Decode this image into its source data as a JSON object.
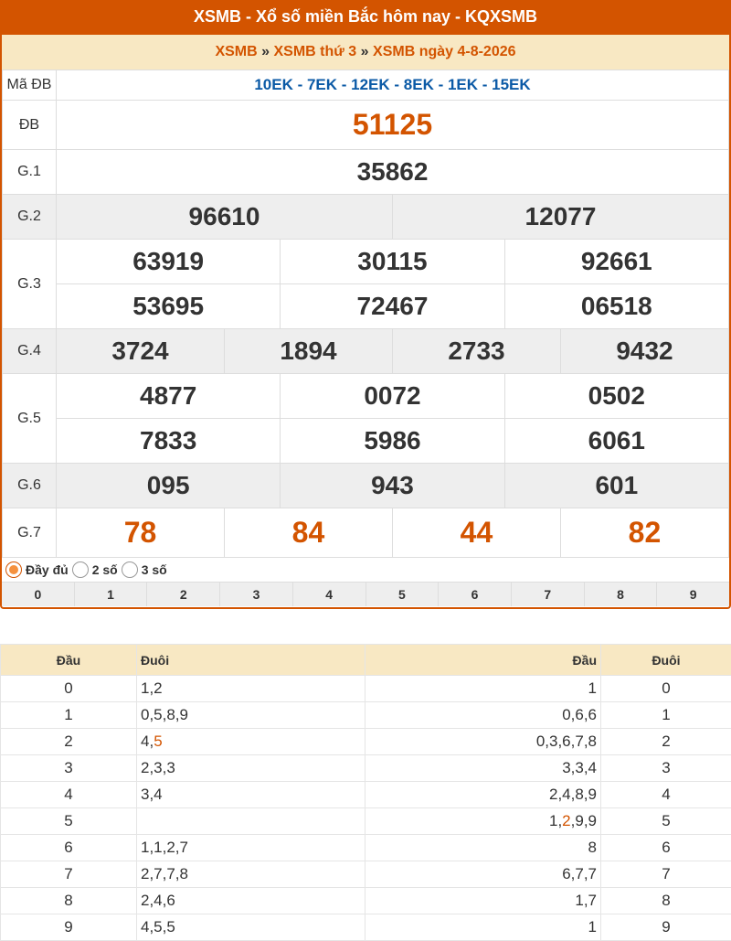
{
  "header": {
    "title": "XSMB - Xổ số miền Bắc hôm nay - KQXSMB"
  },
  "breadcrumb": {
    "link1": "XSMB",
    "link2": "XSMB thứ 3",
    "link3": "XSMB ngày 4-8-2026",
    "sep": "»"
  },
  "madb": {
    "label": "Mã ĐB",
    "value": "10EK - 7EK - 12EK - 8EK - 1EK - 15EK"
  },
  "prizes": {
    "db": {
      "label": "ĐB",
      "value": "51125"
    },
    "g1": {
      "label": "G.1",
      "values": [
        "35862"
      ]
    },
    "g2": {
      "label": "G.2",
      "values": [
        "96610",
        "12077"
      ]
    },
    "g3": {
      "label": "G.3",
      "values": [
        "63919",
        "30115",
        "92661",
        "53695",
        "72467",
        "06518"
      ]
    },
    "g4": {
      "label": "G.4",
      "values": [
        "3724",
        "1894",
        "2733",
        "9432"
      ]
    },
    "g5": {
      "label": "G.5",
      "values": [
        "4877",
        "0072",
        "0502",
        "7833",
        "5986",
        "6061"
      ]
    },
    "g6": {
      "label": "G.6",
      "values": [
        "095",
        "943",
        "601"
      ]
    },
    "g7": {
      "label": "G.7",
      "values": [
        "78",
        "84",
        "44",
        "82"
      ]
    }
  },
  "options": {
    "full": "Đầy đủ",
    "two": "2 số",
    "three": "3 số",
    "selected": "full"
  },
  "digits": [
    "0",
    "1",
    "2",
    "3",
    "4",
    "5",
    "6",
    "7",
    "8",
    "9"
  ],
  "loto": {
    "headers": {
      "dau": "Đầu",
      "duoi": "Đuôi",
      "dau2": "Đầu",
      "duoi2": "Đuôi"
    },
    "rows": [
      {
        "head": "0",
        "tails": "1,2",
        "heads_of": "1",
        "tail": "0"
      },
      {
        "head": "1",
        "tails": "0,5,8,9",
        "heads_of": "0,6,6",
        "tail": "1"
      },
      {
        "head": "2",
        "tails_a": "4,",
        "tails_b": "5",
        "heads_of": "0,3,6,7,8",
        "tail": "2"
      },
      {
        "head": "3",
        "tails": "2,3,3",
        "heads_of": "3,3,4",
        "tail": "3"
      },
      {
        "head": "4",
        "tails": "3,4",
        "heads_of": "2,4,8,9",
        "tail": "4"
      },
      {
        "head": "5",
        "tails": "",
        "heads_a": "1,",
        "heads_b": "2",
        "heads_c": ",9,9",
        "tail": "5"
      },
      {
        "head": "6",
        "tails": "1,1,2,7",
        "heads_of": "8",
        "tail": "6"
      },
      {
        "head": "7",
        "tails": "2,7,7,8",
        "heads_of": "6,7,7",
        "tail": "7"
      },
      {
        "head": "8",
        "tails": "2,4,6",
        "heads_of": "1,7",
        "tail": "8"
      },
      {
        "head": "9",
        "tails": "4,5,5",
        "heads_of": "1",
        "tail": "9"
      }
    ]
  },
  "colors": {
    "accent": "#d35400",
    "header_bg": "#d35400",
    "crumb_bg": "#f8e8c3",
    "madb_blue": "#0b5aa6"
  }
}
